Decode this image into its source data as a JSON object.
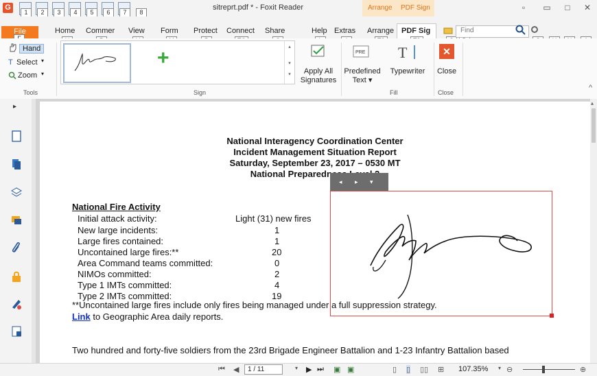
{
  "window": {
    "app_letter": "G",
    "doc_title": "sitreprt.pdf * - Foxit Reader",
    "quick_access_keys": [
      "1",
      "2",
      "3",
      "4",
      "5",
      "6",
      "7",
      "8"
    ],
    "context_group": {
      "arrange": "Arrange",
      "pdf_sign": "PDF Sign"
    },
    "controls": {
      "ribbon_opts": "▫",
      "minimize": "▭",
      "maximize": "□",
      "close": "✕"
    }
  },
  "ribbon_tabs": {
    "file": {
      "label": "File",
      "key": "F"
    },
    "items": [
      {
        "label": "Home",
        "key": "H"
      },
      {
        "label": "Commer",
        "key": "R"
      },
      {
        "label": "View",
        "key": "V"
      },
      {
        "label": "Form",
        "key": "M"
      },
      {
        "label": "Protect",
        "key": "P"
      },
      {
        "label": "Connect",
        "key": "TC"
      },
      {
        "label": "Share",
        "key": "S"
      },
      {
        "label": "Help",
        "key": "L"
      },
      {
        "label": "Extras",
        "key": "I"
      },
      {
        "label": "Arrange",
        "key": "T2"
      },
      {
        "label": "PDF Sig",
        "key": "T3"
      }
    ],
    "right_keys": [
      "Q",
      "D",
      "G",
      "U",
      "N",
      "A"
    ],
    "find_placeholder": "Find"
  },
  "ribbon": {
    "tools": {
      "hand": "Hand",
      "select": "Select",
      "zoom": "Zoom",
      "group_label": "Tools"
    },
    "sign": {
      "apply_all_line1": "Apply All",
      "apply_all_line2": "Signatures",
      "group_label": "Sign"
    },
    "fill": {
      "predefined_line1": "Predefined",
      "predefined_line2": "Text",
      "typewriter": "Typewriter",
      "group_label": "Fill"
    },
    "close": {
      "close": "Close",
      "group_label": "Close"
    }
  },
  "document": {
    "heading_lines": [
      "National Interagency Coordination Center",
      "Incident Management Situation Report",
      "Saturday, September 23, 2017 – 0530 MT",
      "National Preparedness Level 2"
    ],
    "section_title": "National Fire Activity",
    "rows": [
      {
        "label": "Initial attack activity:",
        "value": "Light (31) new fires"
      },
      {
        "label": "New large incidents:",
        "value": "1"
      },
      {
        "label": "Large fires contained:",
        "value": "1"
      },
      {
        "label": "Uncontained large fires:**",
        "value": "20"
      },
      {
        "label": "Area Command teams committed:",
        "value": "0"
      },
      {
        "label": "NIMOs committed:",
        "value": "2"
      },
      {
        "label": "Type 1 IMTs committed:",
        "value": "4"
      },
      {
        "label": "Type 2 IMTs committed:",
        "value": "19"
      }
    ],
    "footnote": "**Uncontained large fires include only fires being managed under a full suppression strategy.",
    "link_text": "Link",
    "link_suffix": " to Geographic Area daily reports.",
    "paragraph": "Two hundred and forty-five soldiers from the 23rd Brigade Engineer Battalion and 1-23 Infantry Battalion based"
  },
  "status": {
    "page_value": "1 / 11",
    "zoom": "107.35%"
  }
}
